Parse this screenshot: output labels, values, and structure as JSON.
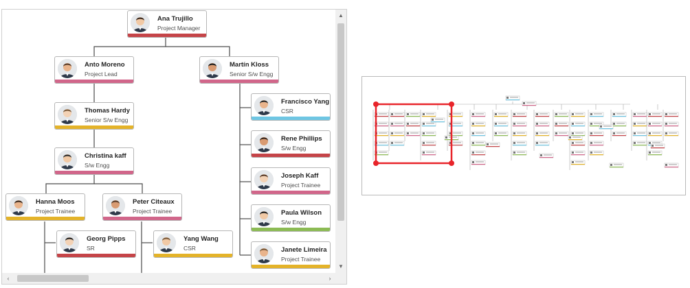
{
  "nodes": [
    {
      "name": "Ana Trujillo",
      "role": "Project Manager",
      "color": "#c54448"
    },
    {
      "name": "Anto Moreno",
      "role": "Project Lead",
      "color": "#d1668a"
    },
    {
      "name": "Martín Kloss",
      "role": "Senior S/w Engg",
      "color": "#d1668a"
    },
    {
      "name": "Thomas Hardy",
      "role": "Senior S/w Engg",
      "color": "#e4b329"
    },
    {
      "name": "Christina kaff",
      "role": "S/w Engg",
      "color": "#d1668a"
    },
    {
      "name": "Hanna Moos",
      "role": "Project Trainee",
      "color": "#e4b329"
    },
    {
      "name": "Peter Citeaux",
      "role": "Project Trainee",
      "color": "#d1668a"
    },
    {
      "name": "Georg Pipps",
      "role": "SR",
      "color": "#c54448"
    },
    {
      "name": "Yang Wang",
      "role": "CSR",
      "color": "#e4b329"
    },
    {
      "name": "Francisco Yang",
      "role": "CSR",
      "color": "#6ec6e3"
    },
    {
      "name": "Rene Phillips",
      "role": "S/w Engg",
      "color": "#c54448"
    },
    {
      "name": "Joseph Kaff",
      "role": "Project Trainee",
      "color": "#d1668a"
    },
    {
      "name": "Paula Wilson",
      "role": "S/w Engg",
      "color": "#8cbb54"
    },
    {
      "name": "Janete Limeira",
      "role": "Project Trainee",
      "color": "#e4b329"
    }
  ],
  "overview": {
    "palette": [
      "#c54448",
      "#d1668a",
      "#e4b329",
      "#6ec6e3",
      "#8cbb54"
    ],
    "viewport_color": "#e8242a"
  }
}
